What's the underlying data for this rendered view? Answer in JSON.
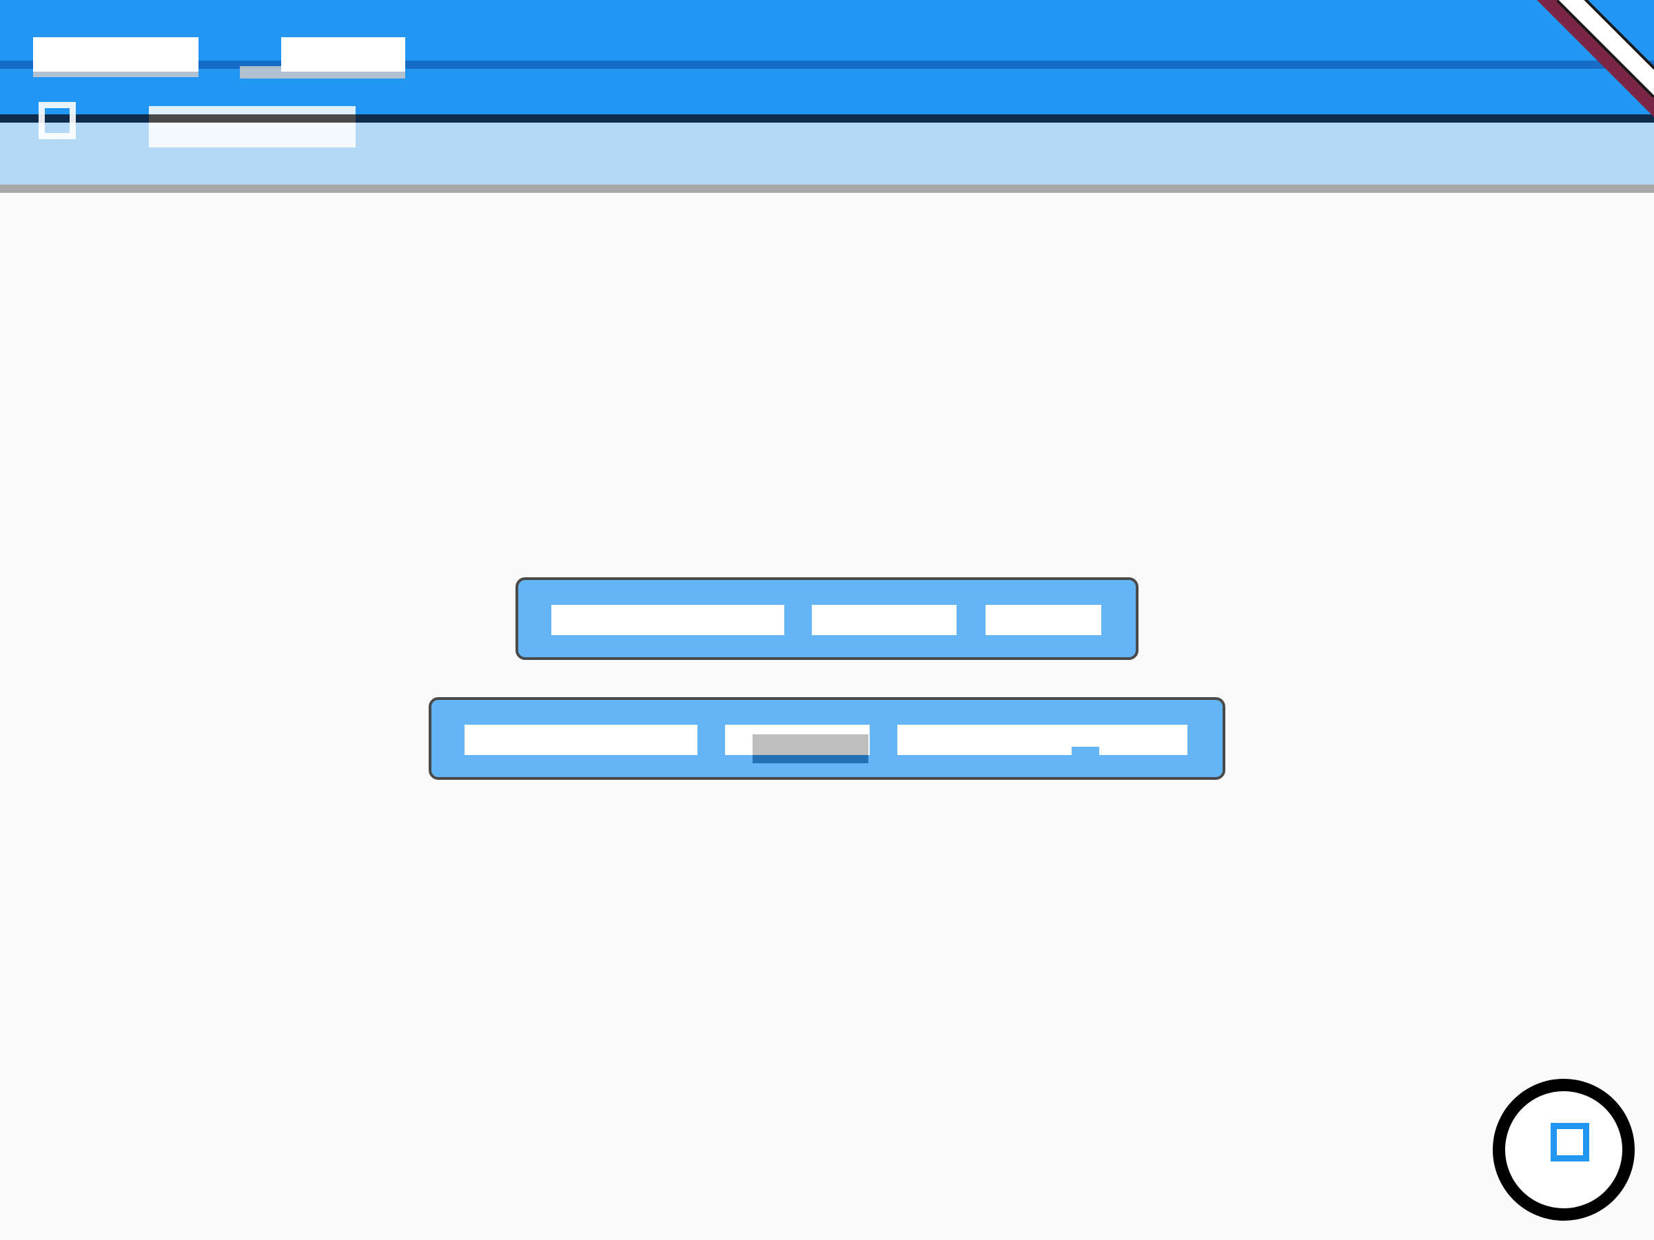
{
  "app": {
    "title_a": "",
    "title_b": "",
    "subtitle": ""
  },
  "toolbar": {
    "close_label": ""
  },
  "actions": {
    "row1": [
      "",
      "",
      ""
    ],
    "row2": [
      "",
      "",
      "",
      ""
    ]
  },
  "fab": {
    "label": ""
  },
  "icons": {
    "menu": "square-outline-icon",
    "close": "close-icon",
    "fab": "square-outline-icon"
  },
  "colors": {
    "primary": "#2196f3",
    "primary_dark": "#1565c0",
    "sub_bar": "#b4d9f6",
    "bar_fill": "#64b5f6",
    "accent": "#7b2645",
    "background": "#fafafa"
  }
}
